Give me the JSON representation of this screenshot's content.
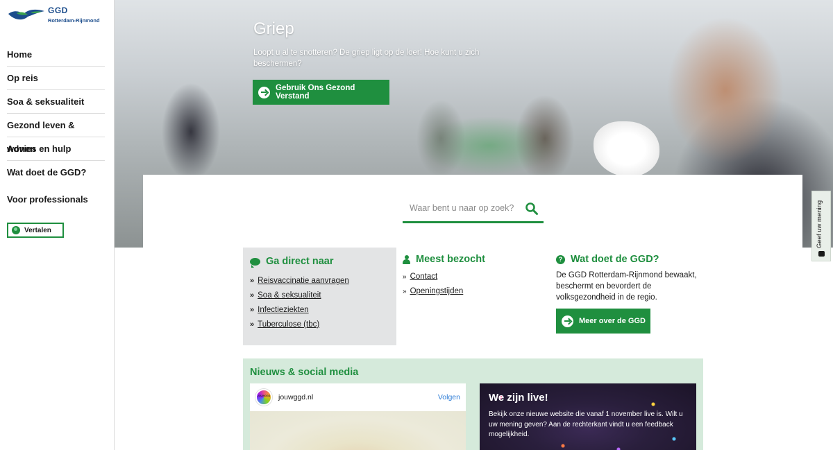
{
  "brand": {
    "name": "GGD",
    "region": "Rotterdam-Rijnmond",
    "accent_color": "#1f8f3f",
    "logo_color": "#1c4d8c"
  },
  "sidebar": {
    "items": [
      {
        "label": "Home"
      },
      {
        "label": "Op reis"
      },
      {
        "label": "Soa & seksualiteit"
      },
      {
        "label": "Gezond leven & wonen"
      },
      {
        "label": "Advies en hulp"
      },
      {
        "label": "Wat doet de GGD?"
      }
    ],
    "professionals": "Voor professionals",
    "translate": {
      "label": "Vertalen",
      "icon": "globe-icon"
    }
  },
  "hero": {
    "title": "Griep",
    "text": "Loopt u al te snotteren? De griep ligt op de loer! Hoe kunt u zich beschermen?",
    "button": "Gebruik Ons Gezond Verstand",
    "button_icon": "arrow-right-circle-icon"
  },
  "search": {
    "placeholder": "Waar bent u naar op zoek?",
    "icon": "search-icon"
  },
  "feedback": {
    "label": "Geef uw mening",
    "icon": "chat-icon"
  },
  "quick_links": {
    "title": "Ga direct naar",
    "icon": "chat-bubble-icon",
    "marker": "»",
    "items": [
      {
        "label": "Reisvaccinatie aanvragen"
      },
      {
        "label": "Soa & seksualiteit"
      },
      {
        "label": "Infectieziekten"
      },
      {
        "label": "Tuberculose (tbc)"
      }
    ]
  },
  "most_visited": {
    "title": "Meest bezocht",
    "icon": "user-icon",
    "marker": "»",
    "items": [
      {
        "label": "Contact"
      },
      {
        "label": "Openingstijden"
      }
    ]
  },
  "about": {
    "title": "Wat doet de GGD?",
    "icon": "question-icon",
    "icon_glyph": "?",
    "text": "De GGD Rotterdam-Rijnmond bewaakt, beschermt en bevordert de volksgezondheid in de regio.",
    "button": "Meer over de GGD"
  },
  "news": {
    "title": "Nieuws & social media",
    "instagram": {
      "account": "jouwggd.nl",
      "avatar_label": "JOUWGGD",
      "follow": "Volgen"
    },
    "live_post": {
      "title": "We zijn live!",
      "text": "Bekijk onze nieuwe website die vanaf 1 november live is. Wilt u uw mening geven? Aan de rechterkant vindt u een feedback mogelijkheid."
    }
  }
}
